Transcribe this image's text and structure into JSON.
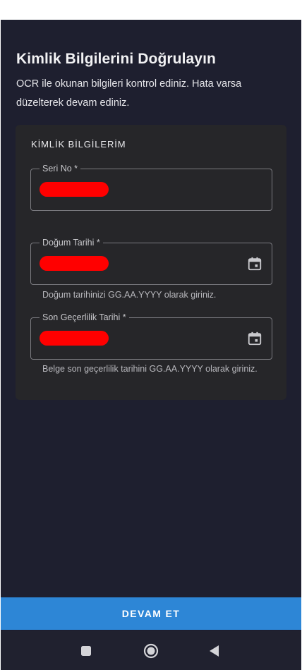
{
  "header": {
    "title": "Kimlik Bilgilerini Doğrulayın",
    "subtitle": "OCR ile okunan bilgileri kontrol ediniz. Hata varsa düzelterek devam ediniz."
  },
  "card": {
    "title": "KİMLİK BİLGİLERİM",
    "fields": [
      {
        "label": "Seri No *",
        "value": "",
        "helper": ""
      },
      {
        "label": "Doğum Tarihi *",
        "value": "",
        "helper": "Doğum tarihinizi GG.AA.YYYY olarak giriniz."
      },
      {
        "label": "Son Geçerlilik Tarihi *",
        "value": "",
        "helper": "Belge son geçerlilik tarihini GG.AA.YYYY olarak giriniz."
      }
    ]
  },
  "actions": {
    "continue_label": "DEVAM ET"
  },
  "colors": {
    "background": "#1e1f2f",
    "card": "#262629",
    "accent": "#2d86d6",
    "redaction": "#ff0000"
  },
  "icons": {
    "calendar": "calendar-icon",
    "nav_recents": "square-icon",
    "nav_home": "circle-icon",
    "nav_back": "triangle-back-icon"
  }
}
